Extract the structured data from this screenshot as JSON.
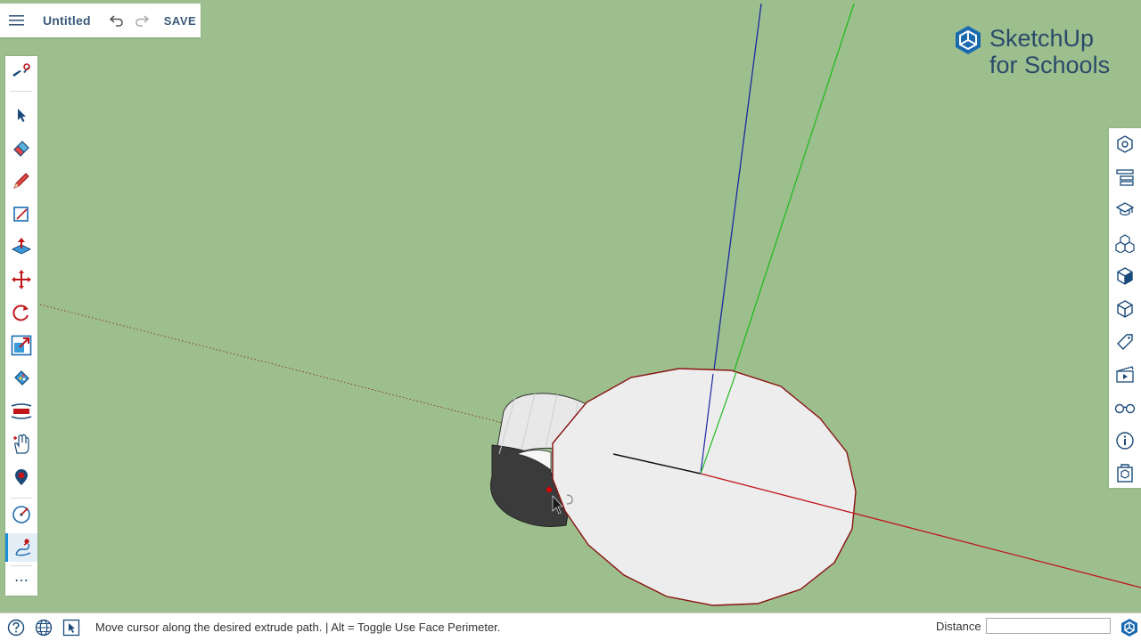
{
  "app": {
    "title": "Untitled",
    "save_label": "SAVE"
  },
  "logo": {
    "line1": "SketchUp",
    "line2": "for Schools"
  },
  "left_toolbar": {
    "tools": [
      "search-icon",
      "select-icon",
      "eraser-icon",
      "pencil-icon",
      "rectangle-icon",
      "push-pull-icon",
      "move-icon",
      "rotate-icon",
      "scale-icon",
      "paint-bucket-icon",
      "tape-measure-icon",
      "pan-icon",
      "orbit-icon",
      "follow-me-icon",
      "circle-icon",
      "more-icon"
    ],
    "more_label": "⋯"
  },
  "right_panel": {
    "tools": [
      "entity-info-icon",
      "outliner-icon",
      "instructor-icon",
      "components-icon",
      "styles-icon",
      "scenes-icon",
      "tags-icon",
      "video-icon",
      "glasses-icon",
      "info-icon",
      "3d-warehouse-icon"
    ]
  },
  "status": {
    "message": "Move cursor along the desired extrude path. | Alt = Toggle Use Face Perimeter.",
    "distance_label": "Distance",
    "distance_value": ""
  },
  "colors": {
    "background": "#9dbf8e",
    "blue_axis": "#1a2aa0",
    "green_axis": "#22bb22",
    "red_axis": "#c0161b",
    "accent": "#1a8ed6"
  }
}
